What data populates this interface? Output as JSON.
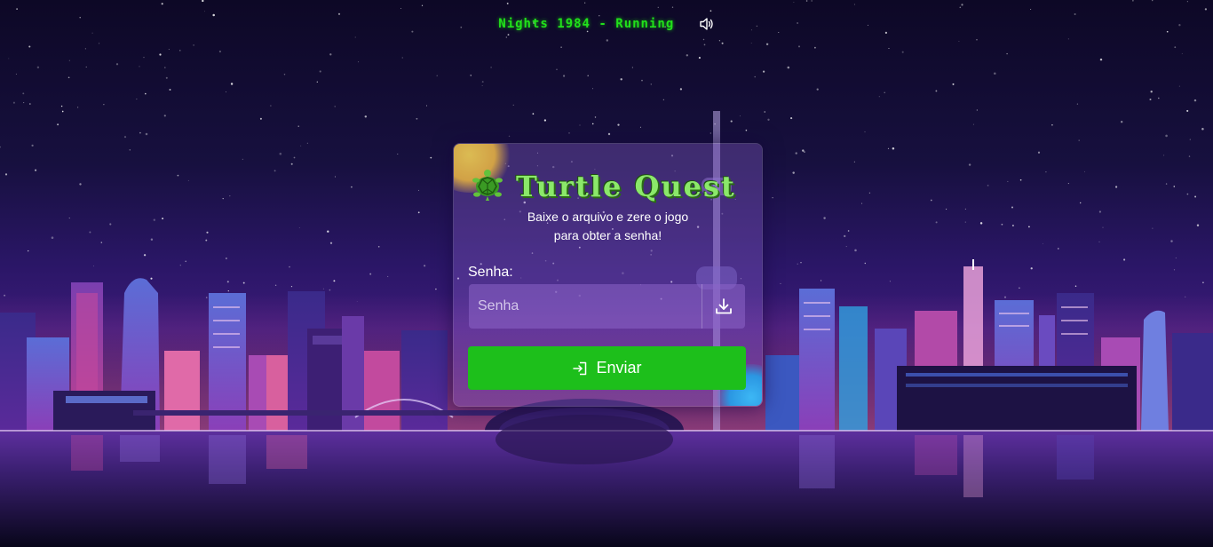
{
  "player": {
    "track_label": "Nights 1984 - Running",
    "icon": "speaker-icon",
    "text_color": "#21e11b"
  },
  "card": {
    "logo_icon": "turtle-icon",
    "title": "Turtle Quest",
    "subtitle_line1": "Baixe o arquivo e zere o jogo",
    "subtitle_line2": "para obter a senha!",
    "password_label": "Senha:",
    "password_value": "",
    "password_placeholder": "Senha",
    "download_icon": "download-icon",
    "submit_icon": "sign-in-icon",
    "submit_label": "Enviar"
  },
  "colors": {
    "accent_green": "#1dbf1b",
    "title_green": "#8be86a",
    "sky_top": "#0d0826",
    "sky_mid": "#3a1a78"
  }
}
